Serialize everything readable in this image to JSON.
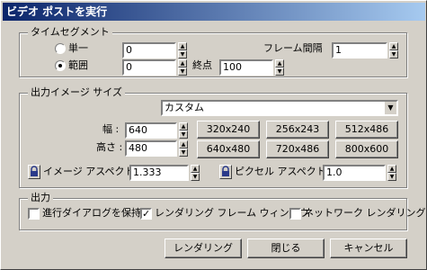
{
  "window": {
    "title": "ビデオ ポストを実行"
  },
  "time_segment": {
    "legend": "タイムセグメント",
    "single_label": "単一",
    "single_value": "0",
    "range_label": "範囲",
    "range_start": "0",
    "end_label": "終点",
    "range_end": "100",
    "frame_interval_label": "フレーム間隔",
    "frame_interval_value": "1",
    "selected": "range"
  },
  "output_size": {
    "legend": "出力イメージ サイズ",
    "preset": "カスタム",
    "width_label": "幅 :",
    "width_value": "640",
    "height_label": "高さ :",
    "height_value": "480",
    "presets": [
      "320x240",
      "256x243",
      "512x486",
      "640x480",
      "720x486",
      "800x600"
    ],
    "image_aspect_label": "イメージ アスペクト :",
    "image_aspect_value": "1.333",
    "pixel_aspect_label": "ピクセル アスペクト :",
    "pixel_aspect_value": "1.0"
  },
  "output": {
    "legend": "出力",
    "keep_progress_label": "進行ダイアログを保持",
    "keep_progress_checked": false,
    "render_window_label": "レンダリング フレーム ウィンドウ",
    "render_window_checked": true,
    "net_render_label": "ネットワーク レンダリング",
    "net_render_checked": false
  },
  "buttons": {
    "render": "レンダリング",
    "close": "閉じる",
    "cancel": "キャンセル"
  },
  "icons": {
    "lock": "lock-icon",
    "spinner": "spinner-icon",
    "dropdown": "chevron-down-icon"
  },
  "colors": {
    "titlebar_start": "#0a246a",
    "titlebar_end": "#a6caf0",
    "face": "#d4d0c8"
  }
}
